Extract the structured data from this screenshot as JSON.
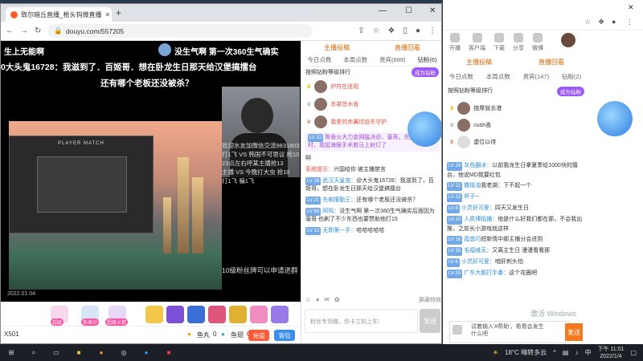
{
  "front_browser": {
    "tab_title": "致尔暗丘直播_枪头钩微直播",
    "url": "douyu.com/557205",
    "video": {
      "line1_left": "生上无能啊",
      "line1_right": "没生气啊 第一次360生气确实",
      "line2": "0大头鬼16728：我滋到了．百姬哥．想在卧龙生日那天给汉堡搞擂台",
      "line3": "还有哪个老板还没被杀？",
      "overlay_lines": [
        "欢迎水友加微信交流9831803",
        "打1飞 VS 韩国不可思议 抢10",
        "23点左右呼某主播抢13",
        "主播 VS 今晚打大虫 抢10",
        "打1飞 骗1飞"
      ],
      "bottom_right_text": "10级粉丝牌可以申请进群",
      "date_stamp": "2022.01.04",
      "game_title": "PLAYER MATCH"
    },
    "gifts": [
      {
        "label": "超级"
      },
      {
        "label": "热卖中"
      },
      {
        "label": "超级火箭"
      }
    ],
    "bottom_bar": {
      "left": "X501",
      "fan_label": "鱼丸",
      "fan_count": "0",
      "fish_label": "鱼翅",
      "fish_count": "0",
      "charge": "充值",
      "bag": "背包"
    },
    "chat": {
      "top_links": [
        "主播投稿",
        "直播回看"
      ],
      "tabs": [
        {
          "label": "今日点数"
        },
        {
          "label": "本周点数"
        },
        {
          "label": "贵宾(689)"
        },
        {
          "label": "钻粉(6)"
        }
      ],
      "head_label": "按照钻粉等级排行",
      "head_button": "成为钻粉",
      "ranks": [
        {
          "name": "炉符在遥观"
        },
        {
          "name": "赤甚皆木香"
        },
        {
          "name": "我爱的赤翼炫焰东守护"
        }
      ],
      "notice_level": "LV 32",
      "notice_text": "陈香火大力金刚猛决@、毫哥。先到本老帮村，我挺海狠手术救马上射灯了",
      "messages": [
        {
          "lv": "",
          "name": "",
          "text": "啊"
        },
        {
          "lv": "",
          "name": "系统提示：",
          "text": "兴国给你 被主播禁言"
        },
        {
          "lv": "LV 26",
          "name": "武汉天皇宠：",
          "text": "@大头鬼16728：我滋到了，百姬哥，想在卧龙生日那天给汉堡搞擂台"
        },
        {
          "lv": "LV 21",
          "name": "先飙撞勤王：",
          "text": "还有哪个老板还没被杀？"
        },
        {
          "lv": "LV 69",
          "name": "阿鸠：",
          "text": "没生气啊 第一次360生气确实后面因为毫哥 也刷了不少东西也要赞助他打15"
        },
        {
          "lv": "LV 12",
          "name": "无即第一手：",
          "text": "哈哈哈哈哈"
        }
      ],
      "input_placeholder": "粉丝专场趣，你卡立刻上车!",
      "send_label": "发送",
      "block_label": "屏蔽特效"
    }
  },
  "back_browser": {
    "nav": [
      "开播",
      "客户端",
      "下载",
      "分享",
      "微博"
    ],
    "top_links": [
      "主播投稿",
      "直播回看"
    ],
    "tabs": [
      "今日点数",
      "本周点数",
      "贵宾(147)",
      "钻粉(2)"
    ],
    "head_label": "按照钻粉等级排行",
    "head_button": "成为钻粉",
    "ranks": [
      {
        "name": "按摩就去港"
      },
      {
        "name": "cush香"
      },
      {
        "name": "虚位以待"
      }
    ],
    "messages": [
      {
        "lv": "LV 24",
        "name": "灰色翻冰：",
        "text": "以前我龙生日拿夏季给1000块的擂台，他说MD我要红包"
      },
      {
        "lv": "LV 21",
        "name": "撒摇浊",
        "text": "我老胡：下不起一个"
      },
      {
        "lv": "LV 22",
        "name": "杯子",
        "text": "--"
      },
      {
        "lv": "LV 8",
        "name": "小灵好可爱：",
        "text": "四天又发生日"
      },
      {
        "lv": "LV 10",
        "name": "人质博抵播：",
        "text": "他是什么好我们都在那，不会我出推，之前长小游戏就这样"
      },
      {
        "lv": "LV 16",
        "name": "孤悠巧",
        "text": "短新情中那主播分会进到"
      },
      {
        "lv": "LV 35",
        "name": "毛福维无：",
        "text": "又离主生日 漫漫看看那"
      },
      {
        "lv": "LV 6",
        "name": "小灵好可爱：",
        "text": "咱肝刺头怕"
      },
      {
        "lv": "LV 29",
        "name": "广东大鹅打手番：",
        "text": "这个花圈吧"
      }
    ],
    "input_text": "试着输入'#帮助'，看看会发生什么吧",
    "send_label": "发送",
    "watermark": "激活 Windows"
  },
  "taskbar": {
    "weather": "18°C 晴转多云",
    "time": "下午 11:01",
    "date": "2022/1/4"
  }
}
